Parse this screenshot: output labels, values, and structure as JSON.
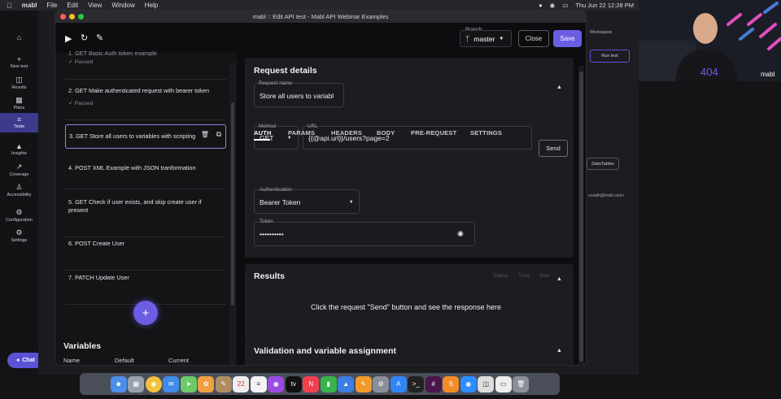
{
  "menubar": {
    "app": "mabl",
    "items": [
      "File",
      "Edit",
      "View",
      "Window",
      "Help"
    ],
    "clock": "Thu Jun 22  12:28 PM"
  },
  "nav": [
    {
      "icon": "home-icon",
      "label": ""
    },
    {
      "icon": "plus-icon",
      "label": "New test"
    },
    {
      "icon": "results-icon",
      "label": "Results"
    },
    {
      "icon": "plans-icon",
      "label": "Plans"
    },
    {
      "icon": "tests-icon",
      "label": "Tests"
    },
    {
      "icon": "insights-icon",
      "label": "Insights"
    },
    {
      "icon": "coverage-icon",
      "label": "Coverage"
    },
    {
      "icon": "accessibility-icon",
      "label": "Accessibility"
    },
    {
      "icon": "configuration-icon",
      "label": "Configuration"
    },
    {
      "icon": "settings-icon",
      "label": "Settings"
    }
  ],
  "chat_label": "Chat",
  "background": {
    "workspace_label": "Workspace",
    "run_test_label": "Run test",
    "datatables_label": "DataTables",
    "email_snippet": "crowth@mabl.com>"
  },
  "window": {
    "title": "mabl :: Edit API test - Mabl API Webinar Examples"
  },
  "toolbar": {
    "branch_label": "Branch",
    "branch_value": "master",
    "close_label": "Close",
    "save_label": "Save"
  },
  "steps": [
    {
      "title": "1. GET Basic Auth token example",
      "status": "Passed"
    },
    {
      "title": "2. GET Make authenticated request with bearer token",
      "status": "Passed"
    },
    {
      "title": "3. GET Store all users to variables with scripting",
      "status": ""
    },
    {
      "title": "4. POST XML Example with JSON tranformation",
      "status": ""
    },
    {
      "title": "5. GET Check if user exists, and skip create user if present",
      "status": ""
    },
    {
      "title": "6. POST Create User",
      "status": ""
    },
    {
      "title": "7. PATCH Update User",
      "status": ""
    }
  ],
  "variables": {
    "title": "Variables",
    "columns": [
      "Name",
      "Default",
      "Current"
    ]
  },
  "request": {
    "title": "Request details",
    "name_label": "Request name",
    "name_value": "Store all users to variabl",
    "method_label": "Method",
    "method_value": "GET",
    "url_label": "URL",
    "url_value": "{{@api.url}}/users?page=2",
    "send_label": "Send",
    "tabs": [
      "AUTH",
      "PARAMS",
      "HEADERS",
      "BODY",
      "PRE-REQUEST",
      "SETTINGS"
    ],
    "auth_label": "Authentication",
    "auth_value": "Bearer Token",
    "token_label": "Token",
    "token_value": "••••••••••"
  },
  "results": {
    "title": "Results",
    "columns": [
      "Status",
      "Time",
      "Size"
    ],
    "empty_text": "Click the request \"Send\" button and see the response here"
  },
  "validation": {
    "title": "Validation and variable assignment"
  },
  "dock_icons": [
    "finder-icon",
    "launchpad-icon",
    "chrome-icon",
    "mail-icon",
    "maps-icon",
    "photos-icon",
    "notes-icon",
    "calendar-icon",
    "reminders-icon",
    "podcasts-icon",
    "tv-icon",
    "news-icon",
    "numbers-icon",
    "keynote-icon",
    "pages-icon",
    "settings-icon",
    "appstore-icon",
    "terminal-icon",
    "slack-icon",
    "sublime-icon",
    "zoom-icon",
    "sequel-icon",
    "preview-icon",
    "trash-icon"
  ]
}
